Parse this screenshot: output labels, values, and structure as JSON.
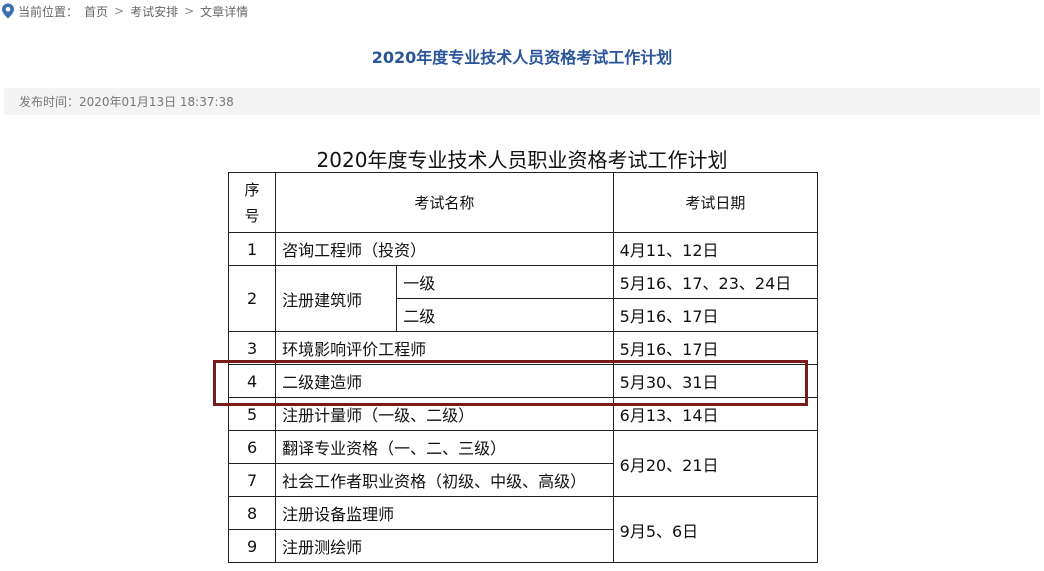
{
  "breadcrumb": {
    "label": "当前位置：",
    "items": [
      "首页",
      "考试安排",
      "文章详情"
    ],
    "separator": ">"
  },
  "article": {
    "title": "2020年度专业技术人员资格考试工作计划",
    "publish_label": "发布时间：",
    "publish_time": "2020年01月13日 18:37:38"
  },
  "table": {
    "title": "2020年度专业技术人员职业资格考试工作计划",
    "headers": {
      "no_line1": "序",
      "no_line2": "号",
      "name": "考试名称",
      "date": "考试日期"
    },
    "rows": [
      {
        "no": "1",
        "name": "咨询工程师（投资）",
        "date": "4月11、12日"
      },
      {
        "no": "2",
        "name": "注册建筑师",
        "sub1": "一级",
        "date1": "5月16、17、23、24日",
        "sub2": "二级",
        "date2": "5月16、17日"
      },
      {
        "no": "3",
        "name": "环境影响评价工程师",
        "date": "5月16、17日"
      },
      {
        "no": "4",
        "name": "二级建造师",
        "date": "5月30、31日"
      },
      {
        "no": "5",
        "name": "注册计量师（一级、二级）",
        "date": "6月13、14日"
      },
      {
        "no": "6",
        "name": "翻译专业资格（一、二、三级）"
      },
      {
        "no": "7",
        "name": "社会工作者职业资格（初级、中级、高级）"
      },
      {
        "no": "8",
        "name": "注册设备监理师"
      },
      {
        "no": "9",
        "name": "注册测绘师"
      }
    ],
    "group_dates": {
      "rows_6_7": "6月20、21日",
      "rows_8_9": "9月5、6日"
    }
  },
  "colors": {
    "title_blue": "#2a5699",
    "highlight_border": "#7a1b1b",
    "meta_bg": "#f4f4f4"
  },
  "icons": {
    "breadcrumb": "location-pin-icon"
  }
}
